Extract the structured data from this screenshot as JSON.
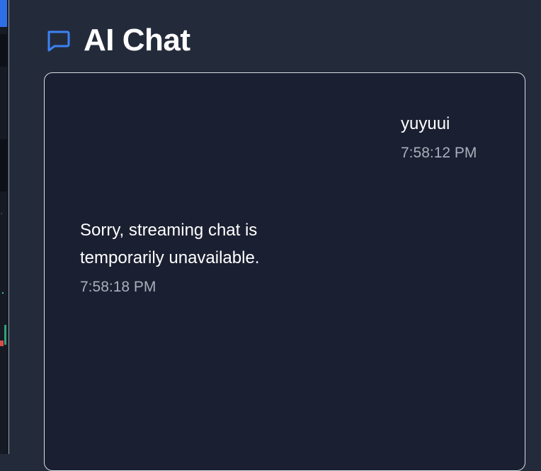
{
  "header": {
    "title": "AI Chat",
    "icon": "chat-bubble-icon",
    "icon_color": "#3b82f6"
  },
  "messages": [
    {
      "role": "user",
      "text": "yuyuui",
      "time": "7:58:12 PM"
    },
    {
      "role": "assistant",
      "text": "Sorry, streaming chat is temporarily unavailable.",
      "time": "7:58:18 PM"
    }
  ],
  "colors": {
    "background": "#232b3b",
    "chat_background": "#1a1f31",
    "timestamp": "#a9afbb"
  }
}
